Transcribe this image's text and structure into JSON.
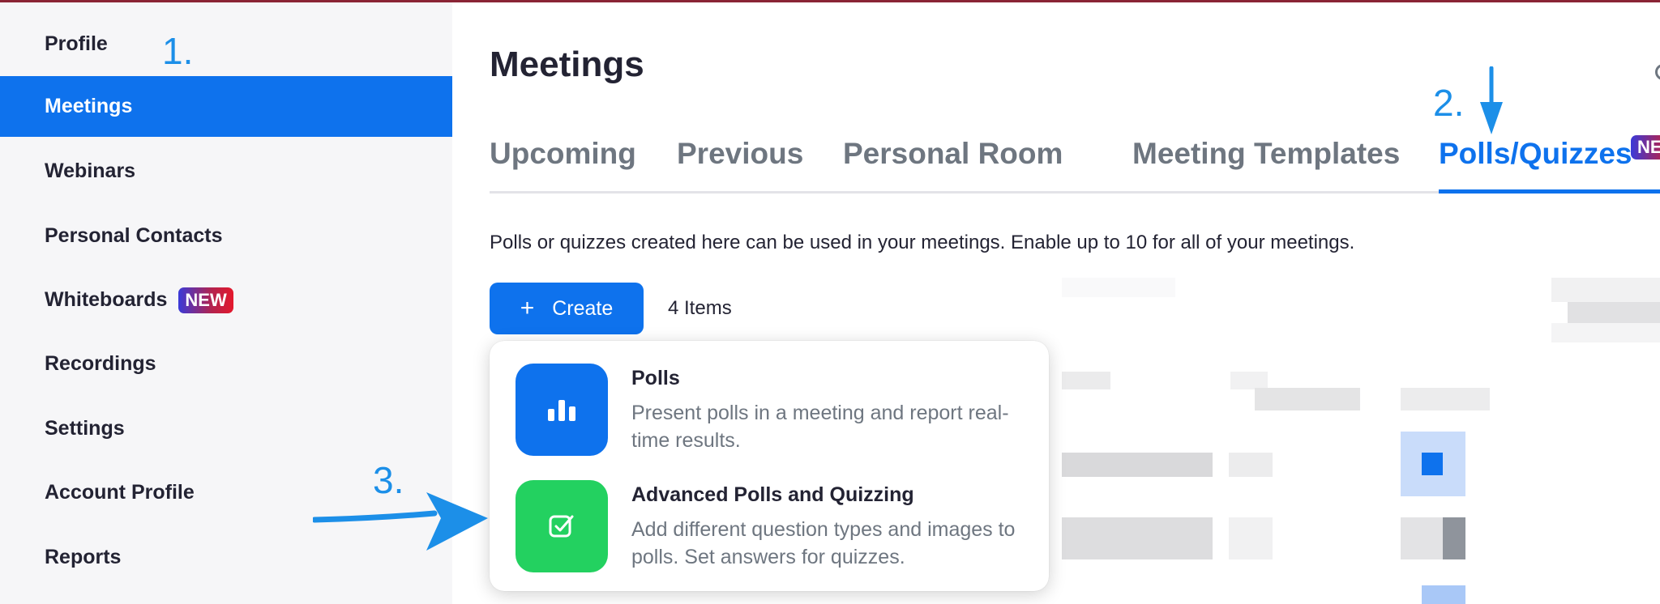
{
  "sidebar": {
    "items": [
      {
        "label": "Profile"
      },
      {
        "label": "Meetings"
      },
      {
        "label": "Webinars"
      },
      {
        "label": "Personal Contacts"
      },
      {
        "label": "Whiteboards",
        "badge": "NEW"
      },
      {
        "label": "Recordings"
      },
      {
        "label": "Settings"
      },
      {
        "label": "Account Profile"
      },
      {
        "label": "Reports"
      }
    ],
    "active": "Meetings"
  },
  "main": {
    "title": "Meetings",
    "tabs": [
      {
        "label": "Upcoming"
      },
      {
        "label": "Previous"
      },
      {
        "label": "Personal Room"
      },
      {
        "label": "Meeting Templates"
      },
      {
        "label": "Polls/Quizzes",
        "badge": "NEW"
      }
    ],
    "active_tab": "Polls/Quizzes",
    "description": "Polls or quizzes created here can be used in your meetings. Enable up to 10 for all of your meetings.",
    "create_label": "Create",
    "items_count": "4 Items"
  },
  "dropdown": {
    "options": [
      {
        "title": "Polls",
        "desc": "Present polls in a meeting and report real-time results.",
        "icon": "bar-chart-icon",
        "color": "#0e72ed"
      },
      {
        "title": "Advanced Polls and Quizzing",
        "desc": "Add different question types and images to polls. Set answers for quizzes.",
        "icon": "checkbox-icon",
        "color": "#23d160"
      }
    ]
  },
  "annotations": {
    "step1": "1.",
    "step2": "2.",
    "step3": "3."
  },
  "colors": {
    "accent": "#0e72ed",
    "annotation": "#1c8fe8",
    "success": "#23d160"
  }
}
